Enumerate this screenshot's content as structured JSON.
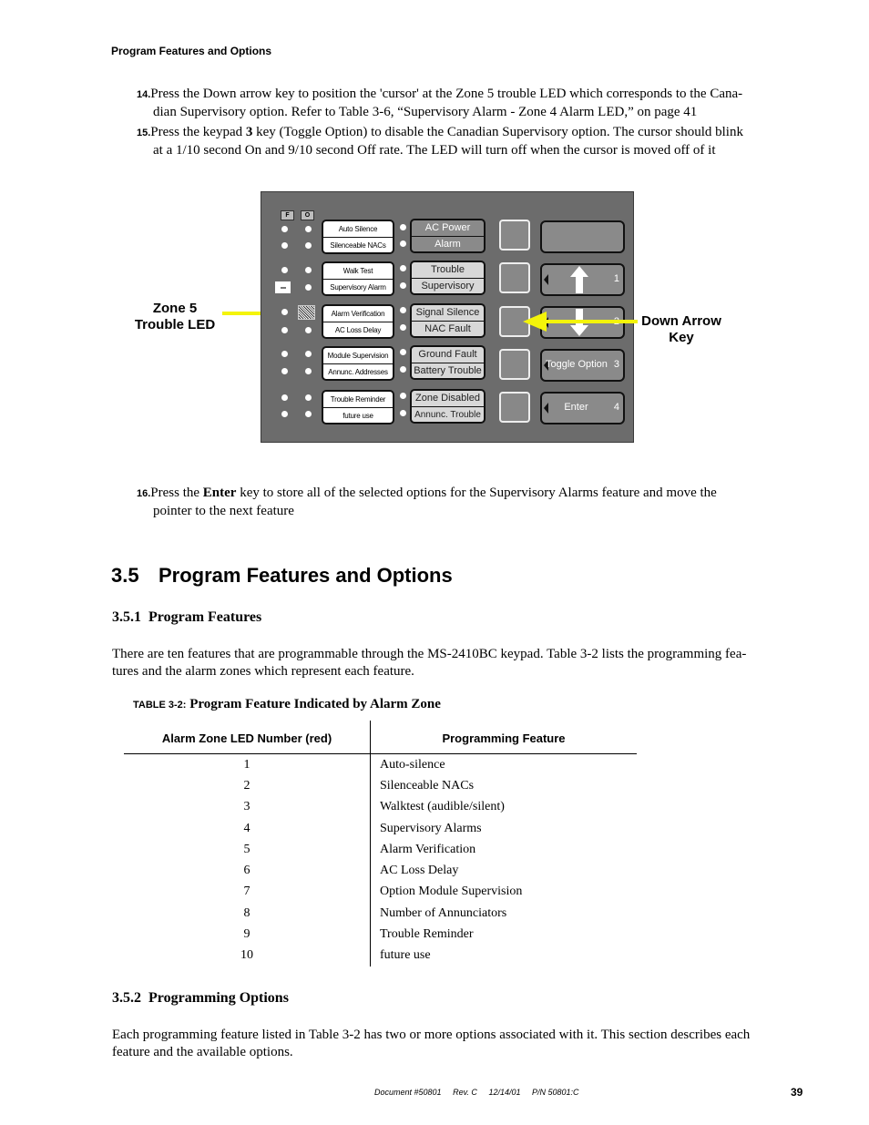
{
  "running_head": "Program Features and Options",
  "steps": [
    {
      "num": "14.",
      "line1": "Press the Down arrow key to position the 'cursor' at the Zone 5 trouble LED which corresponds to the Cana-",
      "line2": "dian Supervisory option.  Refer to Table 3-6, “Supervisory Alarm - Zone 4 Alarm LED,” on page 41"
    },
    {
      "num": "15.",
      "line1_pre": "Press the keypad ",
      "line1_bold": "3",
      "line1_post": " key (Toggle Option) to disable the Canadian Supervisory option.  The cursor should blink",
      "line2": "at a 1/10 second On and 9/10 second Off rate.  The LED will turn off when the cursor is moved off of it"
    },
    {
      "num": "16.",
      "line1_pre": "Press the ",
      "line1_bold": "Enter",
      "line1_post": " key to store all of the selected options for the Supervisory Alarms feature and move the",
      "line2": "pointer to the next feature"
    }
  ],
  "diagram": {
    "column_labels": {
      "f": "F",
      "o": "O"
    },
    "option_groups": [
      [
        "Auto Silence",
        "Silenceable NACs"
      ],
      [
        "Walk Test",
        "Supervisory Alarm"
      ],
      [
        "Alarm Verification",
        "AC Loss Delay"
      ],
      [
        "Module Supervision",
        "Annunc. Addresses"
      ],
      [
        "Trouble Reminder",
        "future use"
      ]
    ],
    "status_groups": [
      [
        "AC Power",
        "Alarm"
      ],
      [
        "Trouble",
        "Supervisory"
      ],
      [
        "Signal Silence",
        "NAC Fault"
      ],
      [
        "Ground Fault",
        "Battery Trouble"
      ],
      [
        "Zone Disabled",
        "Annunc. Trouble"
      ]
    ],
    "keys": [
      {
        "label": "",
        "num": ""
      },
      {
        "label": "",
        "num": "1"
      },
      {
        "label": "",
        "num": "2"
      },
      {
        "label": "Toggle Option",
        "num": "3"
      },
      {
        "label": "Enter",
        "num": "4"
      }
    ],
    "callout_left": {
      "line1": "Zone 5",
      "line2": "Trouble LED"
    },
    "callout_right": {
      "line1": "Down Arrow",
      "line2": "Key"
    },
    "arrow_color": "#f4f40a"
  },
  "section": {
    "num": "3.5",
    "title": "Program Features and Options"
  },
  "sub1": {
    "num": "3.5.1",
    "title": "Program Features",
    "para_line1": "There are ten features that are programmable through the MS-2410BC keypad.  Table 3-2  lists the programming fea-",
    "para_line2": "tures and the alarm zones which represent each feature."
  },
  "table": {
    "label": "TABLE 3-2:",
    "caption": "Program Feature Indicated by Alarm Zone",
    "headers": [
      "Alarm Zone LED Number (red)",
      "Programming Feature"
    ],
    "rows": [
      [
        "1",
        "Auto-silence"
      ],
      [
        "2",
        "Silenceable NACs"
      ],
      [
        "3",
        "Walktest (audible/silent)"
      ],
      [
        "4",
        "Supervisory Alarms"
      ],
      [
        "5",
        "Alarm Verification"
      ],
      [
        "6",
        "AC Loss Delay"
      ],
      [
        "7",
        "Option Module Supervision"
      ],
      [
        "8",
        "Number of Annunciators"
      ],
      [
        "9",
        "Trouble Reminder"
      ],
      [
        "10",
        "future use"
      ]
    ]
  },
  "sub2": {
    "num": "3.5.2",
    "title": "Programming Options",
    "para_line1": "Each programming feature listed in Table 3-2  has two or more options associated with it.  This section describes each",
    "para_line2": "feature and the available options."
  },
  "footer": {
    "doc": "Document #50801",
    "rev": "Rev. C",
    "date": "12/14/01",
    "pn": "P/N 50801:C",
    "page": "39"
  }
}
